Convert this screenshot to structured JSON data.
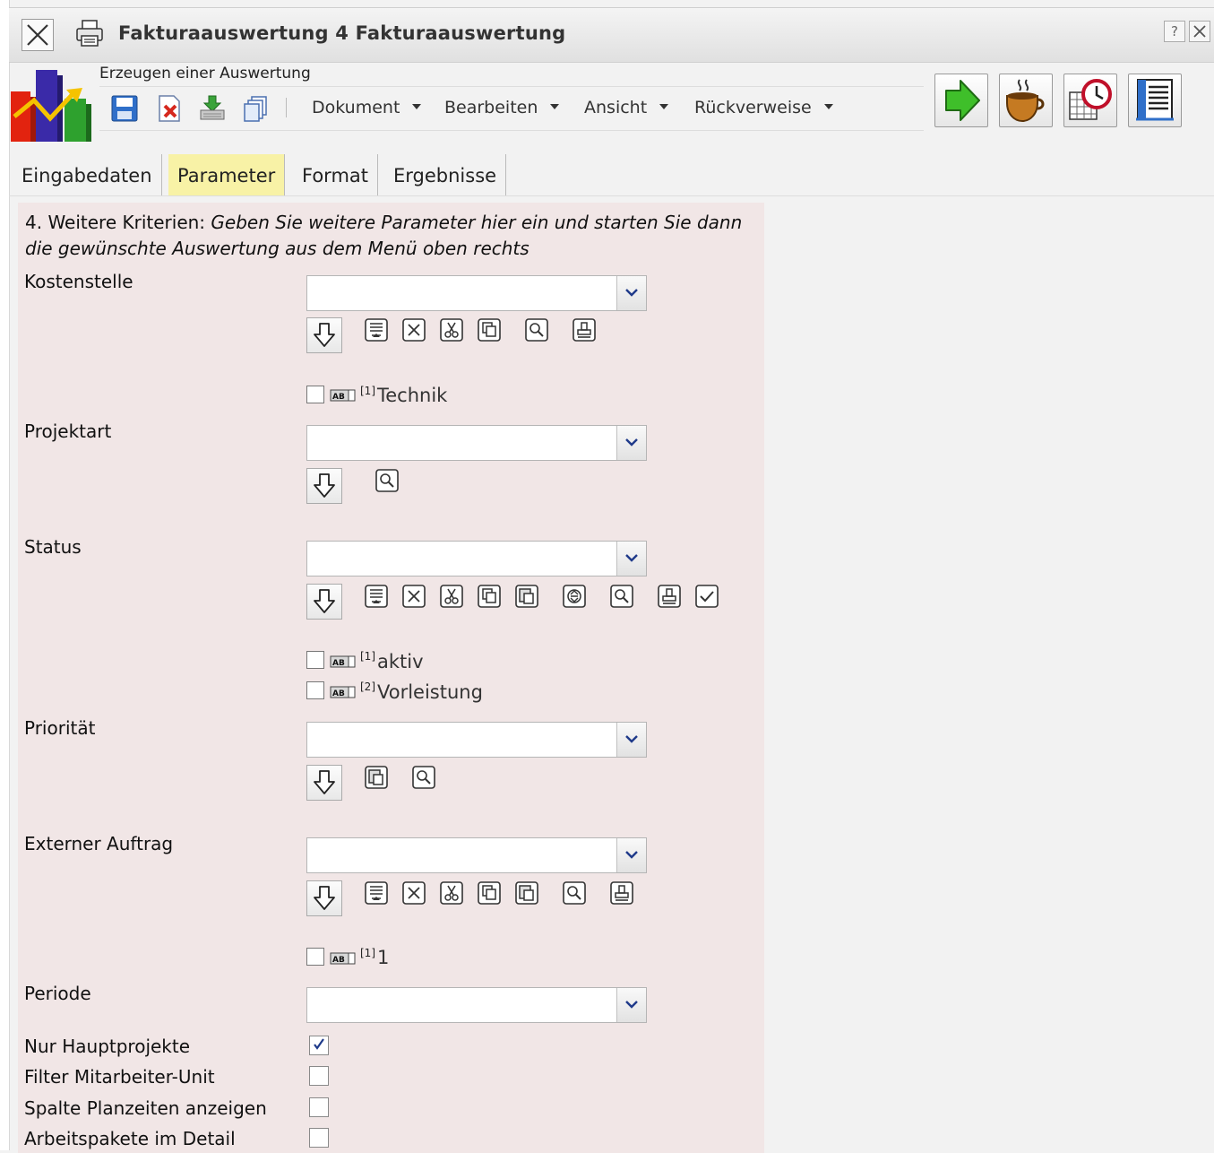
{
  "window": {
    "title": "Fakturaauswertung 4 Fakturaauswertung",
    "help_label": "?"
  },
  "header": {
    "subtitle": "Erzeugen einer Auswertung"
  },
  "menus": [
    {
      "label": "Dokument"
    },
    {
      "label": "Bearbeiten"
    },
    {
      "label": "Ansicht"
    },
    {
      "label": "Rückverweise"
    }
  ],
  "tabs": [
    {
      "label": "Eingabedaten"
    },
    {
      "label": "Parameter"
    },
    {
      "label": "Format"
    },
    {
      "label": "Ergebnisse"
    }
  ],
  "form": {
    "intro_prefix": "4. Weitere Kriterien:",
    "intro_line1": "Geben Sie weitere Parameter hier ein und starten Sie dann",
    "intro_line2": "die gewünschte Auswertung aus dem Menü oben rechts",
    "kostenstelle": {
      "label": "Kostenstelle",
      "value": "",
      "options": [
        {
          "index": "[1]",
          "text": "Technik",
          "checked": false
        }
      ]
    },
    "projektart": {
      "label": "Projektart",
      "value": ""
    },
    "status": {
      "label": "Status",
      "value": "",
      "options": [
        {
          "index": "[1]",
          "text": "aktiv",
          "checked": false
        },
        {
          "index": "[2]",
          "text": "Vorleistung",
          "checked": false
        }
      ]
    },
    "prioritaet": {
      "label": "Priorität",
      "value": ""
    },
    "externer_auftrag": {
      "label": "Externer Auftrag",
      "value": "",
      "options": [
        {
          "index": "[1]",
          "text": "1",
          "checked": false
        }
      ]
    },
    "periode": {
      "label": "Periode",
      "value": ""
    },
    "flags": [
      {
        "label": "Nur Hauptprojekte",
        "checked": true
      },
      {
        "label": "Filter Mitarbeiter-Unit",
        "checked": false
      },
      {
        "label": "Spalte Planzeiten anzeigen",
        "checked": false
      },
      {
        "label": "Arbeitspakete im Detail",
        "checked": false
      }
    ]
  }
}
